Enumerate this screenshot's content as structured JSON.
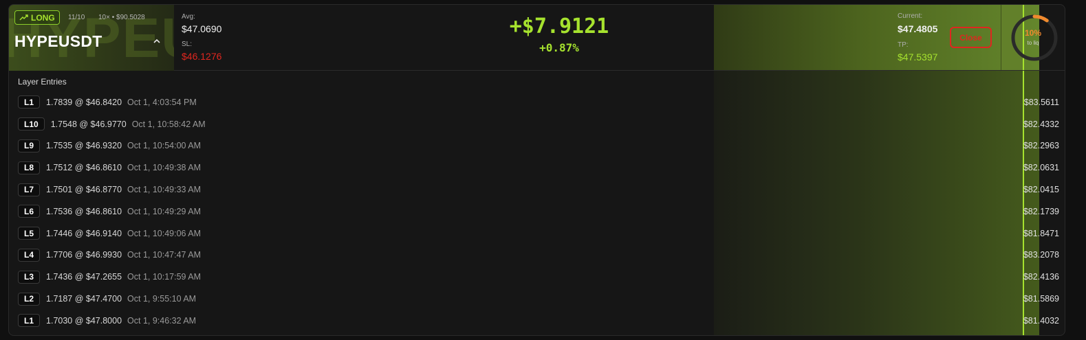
{
  "position": {
    "side": "LONG",
    "layers_count": "11/10",
    "leverage_info": "10× • $90.5028",
    "symbol": "HYPEUSDT",
    "watermark": "HYPEUSDT",
    "avg_label": "Avg:",
    "avg_value": "$47.0690",
    "sl_label": "SL:",
    "sl_value": "$46.1276",
    "pnl": "+$7.9121",
    "pnl_pct": "+0.87%",
    "current_label": "Current:",
    "current_value": "$47.4805",
    "tp_label": "TP:",
    "tp_value": "$47.5397",
    "close_label": "Close",
    "liq_pct": "10%",
    "liq_fraction": 0.1,
    "liq_sub": "to liq"
  },
  "colors": {
    "accent_green": "#a6e22e",
    "danger_red": "#e0261f",
    "warning_orange": "#f08a2e"
  },
  "section_title": "Layer Entries",
  "entries": [
    {
      "layer": "L1",
      "qty_price": "1.7839 @ $46.8420",
      "time": "Oct 1, 4:03:54 PM",
      "value": "$83.5611"
    },
    {
      "layer": "L10",
      "qty_price": "1.7548 @ $46.9770",
      "time": "Oct 1, 10:58:42 AM",
      "value": "$82.4332"
    },
    {
      "layer": "L9",
      "qty_price": "1.7535 @ $46.9320",
      "time": "Oct 1, 10:54:00 AM",
      "value": "$82.2963"
    },
    {
      "layer": "L8",
      "qty_price": "1.7512 @ $46.8610",
      "time": "Oct 1, 10:49:38 AM",
      "value": "$82.0631"
    },
    {
      "layer": "L7",
      "qty_price": "1.7501 @ $46.8770",
      "time": "Oct 1, 10:49:33 AM",
      "value": "$82.0415"
    },
    {
      "layer": "L6",
      "qty_price": "1.7536 @ $46.8610",
      "time": "Oct 1, 10:49:29 AM",
      "value": "$82.1739"
    },
    {
      "layer": "L5",
      "qty_price": "1.7446 @ $46.9140",
      "time": "Oct 1, 10:49:06 AM",
      "value": "$81.8471"
    },
    {
      "layer": "L4",
      "qty_price": "1.7706 @ $46.9930",
      "time": "Oct 1, 10:47:47 AM",
      "value": "$83.2078"
    },
    {
      "layer": "L3",
      "qty_price": "1.7436 @ $47.2655",
      "time": "Oct 1, 10:17:59 AM",
      "value": "$82.4136"
    },
    {
      "layer": "L2",
      "qty_price": "1.7187 @ $47.4700",
      "time": "Oct 1, 9:55:10 AM",
      "value": "$81.5869"
    },
    {
      "layer": "L1",
      "qty_price": "1.7030 @ $47.8000",
      "time": "Oct 1, 9:46:32 AM",
      "value": "$81.4032"
    }
  ]
}
